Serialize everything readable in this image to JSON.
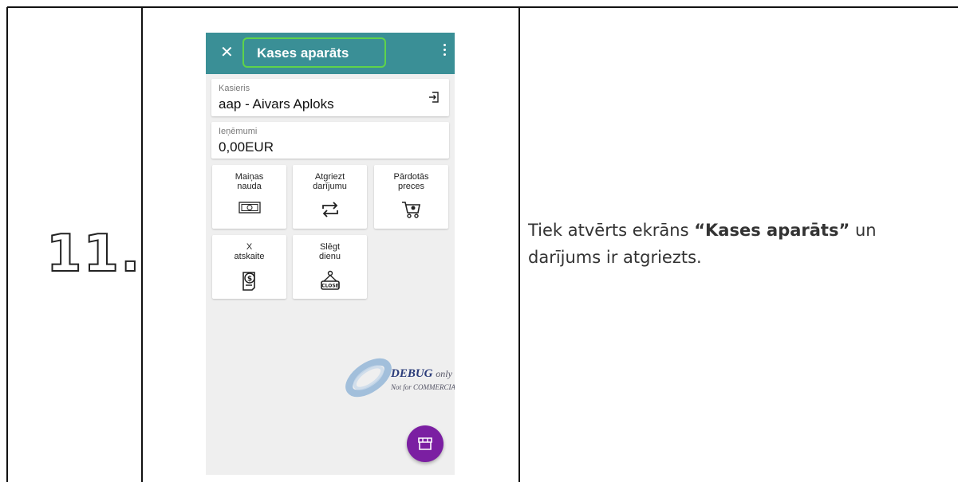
{
  "step": {
    "number": "11."
  },
  "description": {
    "text_before": "Tiek atvērts ekrāns ",
    "highlight": "“Kases aparāts”",
    "text_after": " un",
    "line2": "darījums ir atgriezts."
  },
  "app": {
    "toolbar": {
      "close_icon": "close-icon",
      "title": "Kases aparāts",
      "menu_icon": "more-vert-icon",
      "color": "#3a8f96"
    },
    "cashier": {
      "label": "Kasieris",
      "value": "aap - Aivars Aploks",
      "action_icon": "logout-icon"
    },
    "revenue": {
      "label": "Ieņēmumi",
      "value": "0,00EUR"
    },
    "tiles": [
      {
        "line1": "Maiņas",
        "line2": "nauda",
        "icon": "banknote-icon"
      },
      {
        "line1": "Atgriezt",
        "line2": "darījumu",
        "icon": "swap-arrows-icon"
      },
      {
        "line1": "Pārdotās",
        "line2": "preces",
        "icon": "cart-icon"
      },
      {
        "line1": "X",
        "line2": "atskaite",
        "icon": "receipt-dollar-icon"
      },
      {
        "line1": "Slēgt",
        "line2": "dienu",
        "icon": "closed-sign-icon"
      }
    ],
    "close_sign_text": "CLOSE",
    "watermark": {
      "line1": "DEBUG",
      "line1_suffix": "only",
      "line2": "Not for COMMERCIAL"
    },
    "fab": {
      "icon": "store-icon",
      "color": "#7b1fa2"
    }
  }
}
